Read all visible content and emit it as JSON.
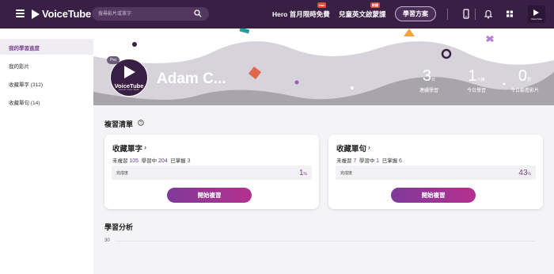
{
  "header": {
    "logo_text": "VoiceTube",
    "search_placeholder": "搜尋影片或單字",
    "nav": [
      {
        "label": "Hero 首月限時免費",
        "badge": "Hot"
      },
      {
        "label": "兒童英文啟蒙課",
        "badge": "新課"
      }
    ],
    "plan_button": "學習方案",
    "avatar_label": "VoiceTube",
    "icons": [
      "menu-icon",
      "search-icon",
      "phone-icon",
      "bell-icon",
      "grid-icon"
    ]
  },
  "sidebar": {
    "items": [
      {
        "label": "我的學習進度",
        "active": true
      },
      {
        "label": "我的影片",
        "active": false
      },
      {
        "label": "收藏單字 (312)",
        "active": false
      },
      {
        "label": "收藏單句 (14)",
        "active": false
      }
    ]
  },
  "profile": {
    "pro_label": "Pro",
    "avatar_label": "VoiceTube",
    "avatar_sub": "Connect. Listen. Speak.",
    "name": "Adam C...",
    "stats": [
      {
        "value": "3",
        "unit": "日",
        "label": "連續學習"
      },
      {
        "value": "1",
        "unit": "分鐘",
        "label": "今日學習"
      },
      {
        "value": "0",
        "unit": "部",
        "label": "今日觀看影片"
      }
    ]
  },
  "review": {
    "title": "複習清單",
    "cards": [
      {
        "title": "收藏單字",
        "unreviewed_label": "未複習",
        "unreviewed": "105",
        "learning_label": "學習中",
        "learning": "204",
        "mastered_label": "已掌握",
        "mastered": "3",
        "progress_label": "完成度",
        "progress": "1",
        "progress_unit": "%",
        "button": "開始複習"
      },
      {
        "title": "收藏單句",
        "unreviewed_label": "未複習",
        "unreviewed": "7",
        "learning_label": "學習中",
        "learning": "1",
        "mastered_label": "已掌握",
        "mastered": "6",
        "progress_label": "完成度",
        "progress": "43",
        "progress_unit": "%",
        "button": "開始複習"
      }
    ]
  },
  "analysis": {
    "title": "學習分析",
    "axis_value": "30"
  },
  "colors": {
    "topbar": "#3a1f44",
    "accent": "#7a3f8e",
    "button_gradient_start": "#7f3a9a",
    "button_gradient_end": "#b5308f"
  }
}
